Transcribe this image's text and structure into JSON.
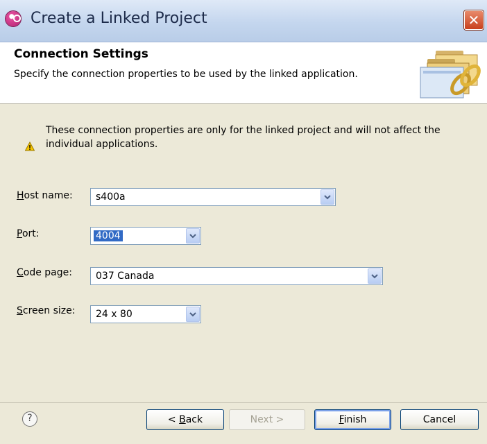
{
  "window": {
    "title": "Create a Linked Project"
  },
  "banner": {
    "title": "Connection Settings",
    "description": "Specify the connection properties to be used by the linked application."
  },
  "warning": {
    "text": "These connection properties are only for the linked project and will not affect the individual applications."
  },
  "fields": {
    "host_name": {
      "label_mnemonic": "H",
      "label_rest": "ost name:",
      "value": "s400a"
    },
    "port": {
      "label_mnemonic": "P",
      "label_rest": "ort:",
      "value": "4004"
    },
    "code_page": {
      "label_mnemonic": "C",
      "label_rest": "ode page:",
      "value": "037 Canada"
    },
    "screen_size": {
      "label_mnemonic": "S",
      "label_rest": "creen size:",
      "value": "24 x 80"
    }
  },
  "footer": {
    "help_symbol": "?",
    "back": {
      "prefix": "< ",
      "mnemonic": "B",
      "rest": "ack"
    },
    "next_label": "Next >",
    "finish": {
      "mnemonic": "F",
      "rest": "inish"
    },
    "cancel_label": "Cancel"
  }
}
